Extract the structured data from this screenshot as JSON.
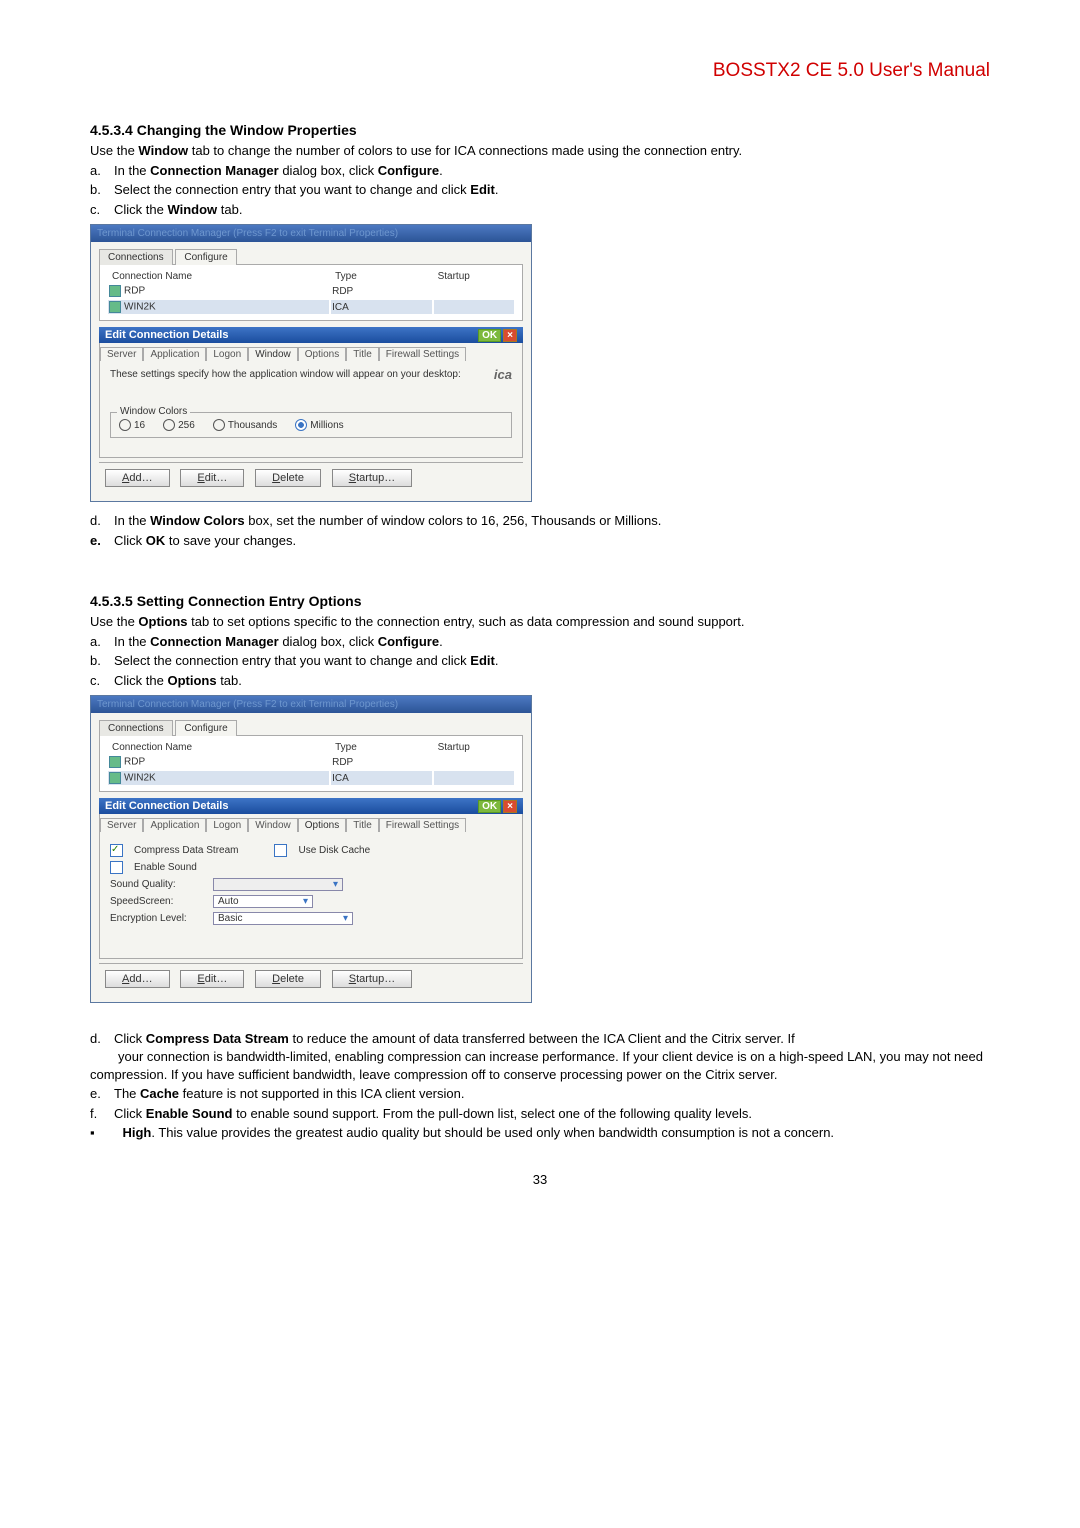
{
  "header": {
    "manual_title": "BOSSTX2 CE 5.0 User's Manual"
  },
  "s1": {
    "heading": "4.5.3.4  Changing the Window Properties",
    "intro": "Use the Window tab to change the number of colors to use for ICA connections made using the connection entry.",
    "a": "In the Connection Manager dialog box, click Configure.",
    "b": "Select the connection entry that you want to change and click Edit.",
    "c": "Click the Window tab.",
    "d": "In the Window Colors box, set the number of window colors to 16, 256, Thousands or Millions.",
    "e": "Click OK to save your changes."
  },
  "s2": {
    "heading": "4.5.3.5  Setting Connection Entry Options",
    "intro": "Use the Options tab to set options specific to the connection entry, such as data compression and sound support.",
    "a": "In the Connection Manager dialog box, click Configure.",
    "b": "Select the connection entry that you want to change and click Edit.",
    "c": "Click the Options tab.",
    "d": "Click Compress Data Stream to reduce the amount of data transferred between the ICA Client and the Citrix server. If your connection is bandwidth-limited, enabling compression can increase performance. If your client device is on a high-speed LAN, you may not need compression. If you have sufficient bandwidth, leave compression off to conserve processing power on the Citrix server.",
    "e": "The Cache feature is not supported in this ICA client version.",
    "f": "Click Enable Sound to enable sound support. From the pull-down list, select one of the following quality levels.",
    "high": "High. This value provides the greatest audio quality but should be used only when bandwidth consumption is not a concern."
  },
  "ss": {
    "tcm_title": "Terminal Connection Manager (Press F2 to exit Terminal Properties)",
    "tab_connections": "Connections",
    "tab_configure": "Configure",
    "col_name": "Connection Name",
    "col_type": "Type",
    "col_startup": "Startup",
    "row_rdp": "RDP",
    "row_rdp_type": "RDP",
    "row_win2k": "WIN2K",
    "row_win2k_type": "ICA",
    "edit_title": "Edit Connection Details",
    "ok": "OK",
    "x": "×",
    "t_server": "Server",
    "t_application": "Application",
    "t_logon": "Logon",
    "t_window": "Window",
    "t_options": "Options",
    "t_title": "Title",
    "t_firewall": "Firewall Settings",
    "win_msg": "These settings specify how the application window will appear on your desktop:",
    "ica_logo": "ica",
    "legend_colors": "Window Colors",
    "r16": "16",
    "r256": "256",
    "rthou": "Thousands",
    "rmill": "Millions",
    "opt_cds": "Compress Data Stream",
    "opt_udc": "Use Disk Cache",
    "opt_es": "Enable Sound",
    "lbl_sq": "Sound Quality:",
    "lbl_ss": "SpeedScreen:",
    "val_ss": "Auto",
    "lbl_el": "Encryption Level:",
    "val_el": "Basic",
    "btn_add": "Add…",
    "btn_edit": "Edit…",
    "btn_delete": "Delete",
    "btn_startup": "Startup…"
  },
  "page_number": "33"
}
